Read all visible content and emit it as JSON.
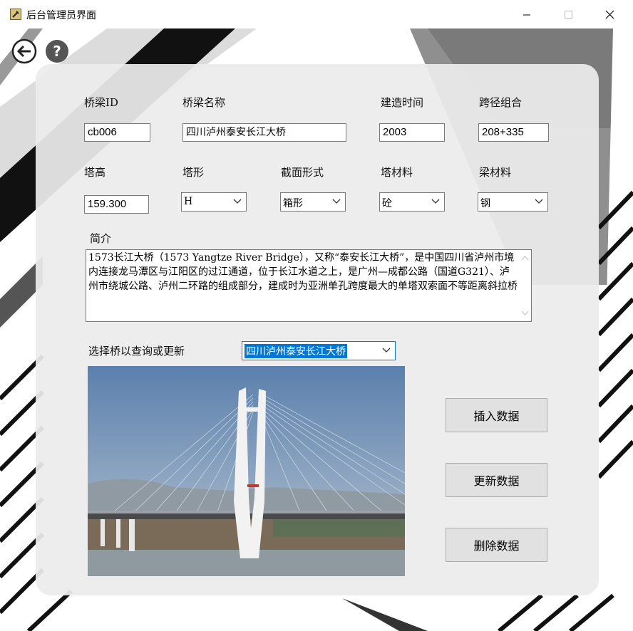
{
  "window": {
    "title": "后台管理员界面",
    "controls": [
      "minimize-icon",
      "maximize-icon",
      "close-icon"
    ]
  },
  "nav": {
    "back_icon": "back-arrow-icon",
    "help_icon": "help-icon"
  },
  "form": {
    "bridge_id": {
      "label": "桥梁ID",
      "value": "cb006"
    },
    "bridge_name": {
      "label": "桥梁名称",
      "value": "四川泸州泰安长江大桥"
    },
    "build_time": {
      "label": "建造时间",
      "value": "2003"
    },
    "span": {
      "label": "跨径组合",
      "value": "208+335"
    },
    "tower_height": {
      "label": "塔高",
      "value": "159.300"
    },
    "tower_shape": {
      "label": "塔形",
      "value": "H"
    },
    "section": {
      "label": "截面形式",
      "value": "箱形"
    },
    "tower_material": {
      "label": "塔材料",
      "value": "砼"
    },
    "beam_material": {
      "label": "梁材料",
      "value": "钢"
    },
    "intro": {
      "label": "简介",
      "value": "1573长江大桥（1573 Yangtze River Bridge），又称“泰安长江大桥”，是中国四川省泸州市境内连接龙马潭区与江阳区的过江通道，位于长江水道之上，是广州—成都公路（国道G321）、泸州市绕城公路、泸州二环路的组成部分，建成时为亚洲单孔跨度最大的单塔双索面不等距离斜拉桥"
    },
    "select": {
      "label": "选择桥以查询或更新",
      "value": "四川泸州泰安长江大桥"
    }
  },
  "buttons": {
    "insert": "插入数据",
    "update": "更新数据",
    "delete": "删除数据"
  },
  "colors": {
    "panel": "#ececec",
    "selection": "#0078d7",
    "button": "#e1e1e1"
  }
}
